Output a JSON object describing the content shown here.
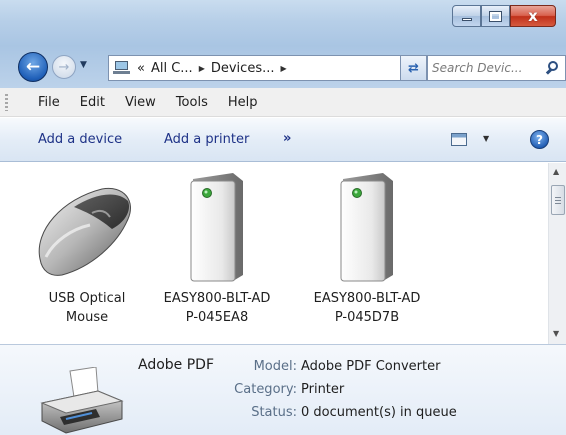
{
  "window": {
    "minimize_glyph": "",
    "close_glyph": "x"
  },
  "nav": {
    "back_glyph": "←",
    "forward_glyph": "→",
    "history_glyph": "▼",
    "breadcrumb_prefix": "«",
    "breadcrumb": [
      "All C...",
      "Devices..."
    ],
    "breadcrumb_sep": "▶",
    "address_drop_glyph": "▼",
    "refresh_glyph": "⇄",
    "search_placeholder": "Search Devic..."
  },
  "menu": {
    "items": [
      "File",
      "Edit",
      "View",
      "Tools",
      "Help"
    ]
  },
  "commands": {
    "add_device": "Add a device",
    "add_printer": "Add a printer",
    "more": "»",
    "view_drop_glyph": "▼",
    "help_glyph": "?"
  },
  "devices": [
    {
      "label": "USB Optical\nMouse",
      "icon": "mouse-icon"
    },
    {
      "label": "EASY800-BLT-AD\nP-045EA8",
      "icon": "server-icon"
    },
    {
      "label": "EASY800-BLT-AD\nP-045D7B",
      "icon": "server-icon"
    }
  ],
  "scrollbar": {
    "up_glyph": "▲",
    "down_glyph": "▼"
  },
  "details": {
    "name": "Adobe PDF",
    "icon": "printer-icon",
    "model_label": "Model:",
    "model_value": "Adobe PDF Converter",
    "category_label": "Category:",
    "category_value": "Printer",
    "status_label": "Status:",
    "status_value": "0 document(s) in queue"
  },
  "colors": {
    "command_text": "#1e3287",
    "glass_top": "#c9dcef",
    "details_label": "#5a6f88",
    "close_button": "#c0301a"
  }
}
